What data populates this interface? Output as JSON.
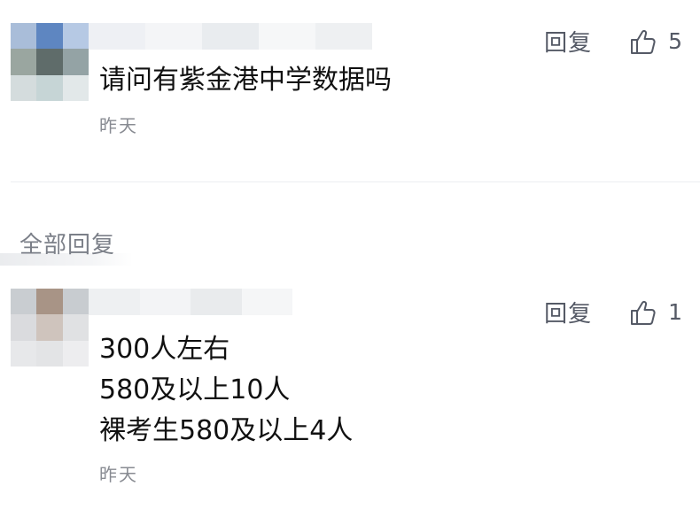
{
  "comments": [
    {
      "reply_label": "回复",
      "like_count": "5",
      "lines": [
        "请问有紫金港中学数据吗"
      ],
      "time": "昨天",
      "avatar_colors": [
        "#a9bdd9",
        "#5e86c1",
        "#b6c9e4",
        "#9aa6a0",
        "#5f6c6a",
        "#94a3a5",
        "#d4dcdd",
        "#c6d5d6",
        "#e2e8e9"
      ],
      "name_blur_colors": [
        "#eef0f4",
        "#f4f5f7",
        "#e9ecef",
        "#f6f7f8",
        "#eef0f2"
      ]
    },
    {
      "reply_label": "回复",
      "like_count": "1",
      "lines": [
        "300人左右",
        "580及以上10人",
        "裸考生580及以上4人"
      ],
      "time": "昨天",
      "avatar_colors": [
        "#c9cdd1",
        "#a89486",
        "#c8ccd0",
        "#dadbde",
        "#cfc4bd",
        "#e0e1e3",
        "#e7e8ea",
        "#e3e4e6",
        "#ededef"
      ],
      "name_blur_colors": [
        "#eef0f2",
        "#f3f4f6",
        "#e9ebed",
        "#f5f6f7"
      ]
    }
  ],
  "section": {
    "title": "全部回复"
  },
  "colors": {
    "text": "#111111",
    "muted": "#888b92",
    "action": "#555a66"
  }
}
